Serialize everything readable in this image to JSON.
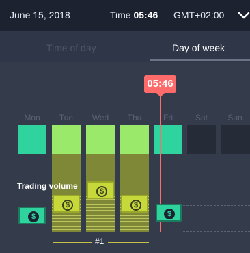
{
  "header": {
    "date": "June 15, 2018",
    "time_label": "Time",
    "time_value": "05:46",
    "timezone": "GMT+02:00"
  },
  "tabs": [
    {
      "label": "Time of day",
      "active": false
    },
    {
      "label": "Day of week",
      "active": true
    }
  ],
  "cursor": {
    "time": "05:46"
  },
  "days": [
    "Mon",
    "Tue",
    "Wed",
    "Thu",
    "Fri",
    "Sat",
    "Sun"
  ],
  "trading_volume_label": "Trading volume",
  "group_label": "#1",
  "colors": {
    "accent": "#ff6b6b",
    "teal": "#2ed39e",
    "lime": "#9be96a",
    "volume": "#c7d83b"
  }
}
